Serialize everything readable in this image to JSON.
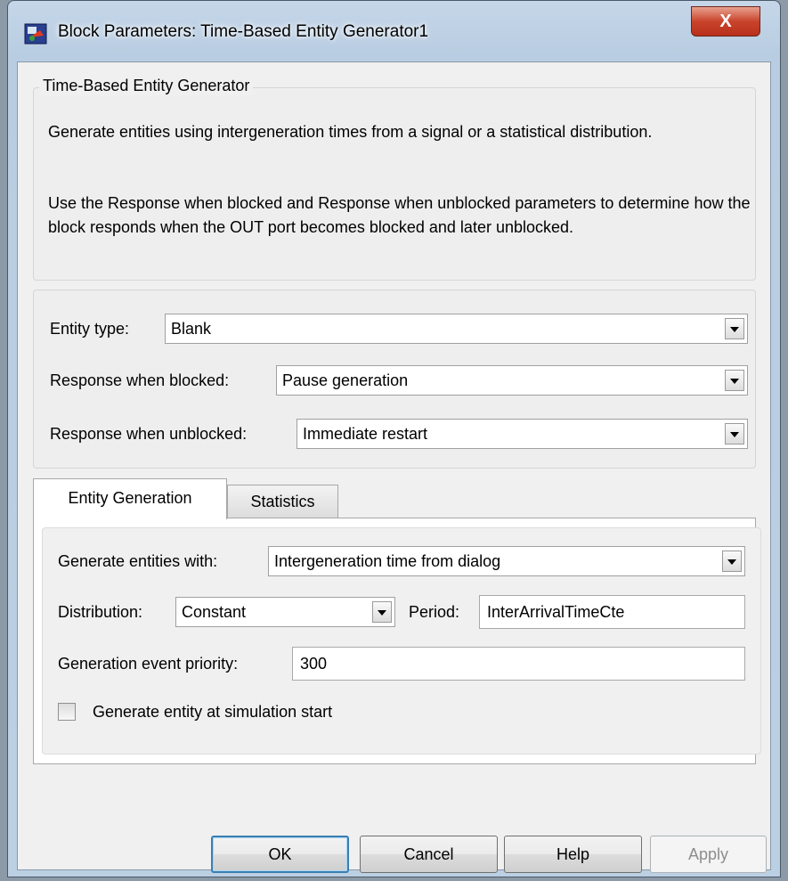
{
  "window": {
    "title": "Block Parameters: Time-Based Entity Generator1",
    "close_label": "X"
  },
  "description": {
    "group_title": "Time-Based Entity Generator",
    "paragraph1": "Generate entities using intergeneration times from a signal or a statistical distribution.",
    "paragraph2": "Use the Response when blocked and Response when unblocked parameters to determine how the block responds when the OUT port becomes blocked and later unblocked."
  },
  "params": {
    "entity_type_label": "Entity type:",
    "entity_type_value": "Blank",
    "blocked_label": "Response when blocked:",
    "blocked_value": "Pause generation",
    "unblocked_label": "Response when unblocked:",
    "unblocked_value": "Immediate restart"
  },
  "tabs": [
    {
      "label": "Entity Generation",
      "active": true
    },
    {
      "label": "Statistics",
      "active": false
    }
  ],
  "entity_generation": {
    "generate_with_label": "Generate entities with:",
    "generate_with_value": "Intergeneration time from dialog",
    "distribution_label": "Distribution:",
    "distribution_value": "Constant",
    "period_label": "Period:",
    "period_value": "InterArrivalTimeCte",
    "priority_label": "Generation event priority:",
    "priority_value": "300",
    "start_checkbox_label": "Generate entity at simulation start",
    "start_checkbox_checked": false
  },
  "buttons": {
    "ok": "OK",
    "cancel": "Cancel",
    "help": "Help",
    "apply": "Apply"
  },
  "colors": {
    "close_button": "#c9442b",
    "default_button_border": "#3c7fb1",
    "dialog_background": "#f0f0f0"
  }
}
